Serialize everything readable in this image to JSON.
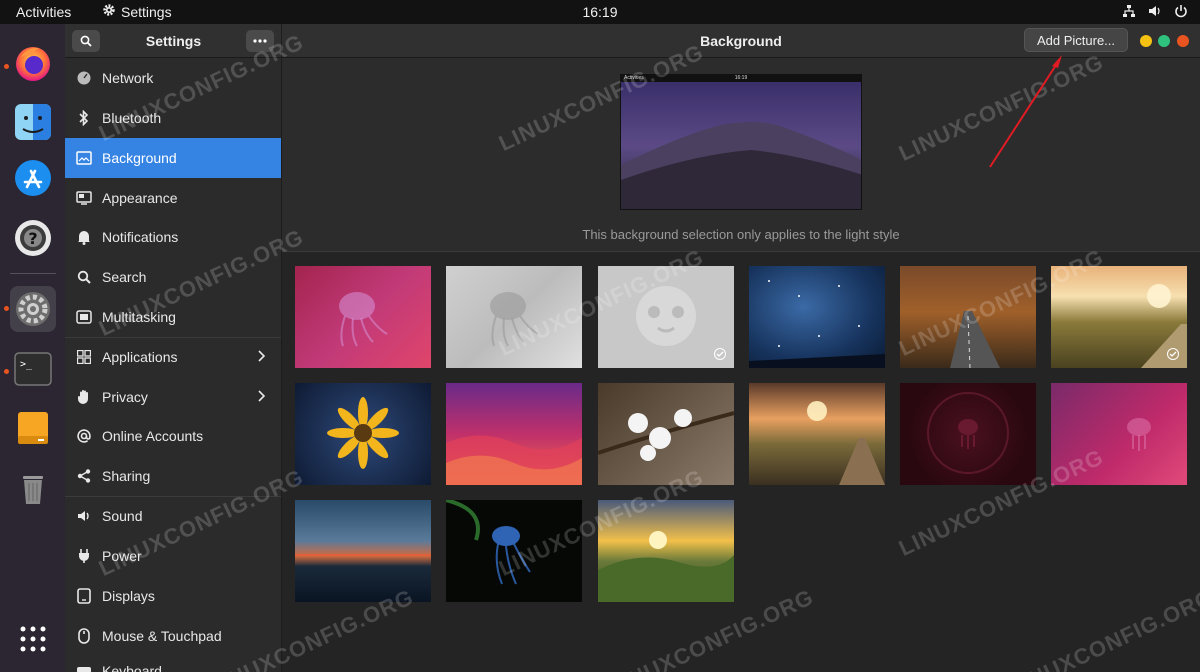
{
  "topbar": {
    "activities": "Activities",
    "app_name": "Settings",
    "clock": "16:19"
  },
  "headerbar": {
    "left_title": "Settings",
    "page_title": "Background",
    "add_picture": "Add Picture..."
  },
  "sidebar": {
    "items": [
      {
        "label": "Network",
        "icon": "network-icon"
      },
      {
        "label": "Bluetooth",
        "icon": "bluetooth-icon"
      },
      {
        "label": "Background",
        "icon": "background-icon"
      },
      {
        "label": "Appearance",
        "icon": "appearance-icon"
      },
      {
        "label": "Notifications",
        "icon": "bell-icon"
      },
      {
        "label": "Search",
        "icon": "search-icon"
      },
      {
        "label": "Multitasking",
        "icon": "multitasking-icon"
      },
      {
        "label": "Applications",
        "icon": "applications-icon"
      },
      {
        "label": "Privacy",
        "icon": "hand-icon"
      },
      {
        "label": "Online Accounts",
        "icon": "at-icon"
      },
      {
        "label": "Sharing",
        "icon": "share-icon"
      },
      {
        "label": "Sound",
        "icon": "speaker-icon"
      },
      {
        "label": "Power",
        "icon": "power-icon"
      },
      {
        "label": "Displays",
        "icon": "display-icon"
      },
      {
        "label": "Mouse & Touchpad",
        "icon": "mouse-icon"
      }
    ],
    "partial_item": "Keyboard"
  },
  "preview": {
    "mini_activities": "Activities",
    "mini_clock": "16:19",
    "note": "This background selection only applies to the light style"
  },
  "watermark": "LINUXCONFIG.ORG",
  "colors": {
    "accent": "#3584e4",
    "close": "#e95420",
    "minimize": "#f5c211",
    "maximize": "#2ec27e",
    "arrow": "#e01b24"
  }
}
